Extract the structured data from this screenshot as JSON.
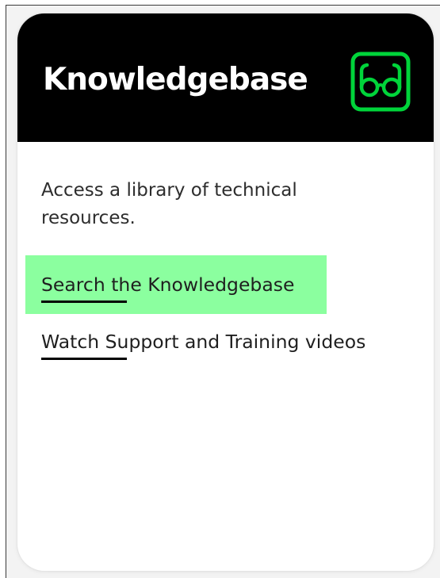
{
  "card": {
    "title": "Knowledgebase",
    "icon": "glasses-icon",
    "description": "Access a library of technical resources.",
    "links": [
      {
        "label": "Search the Knowledgebase",
        "highlighted": true
      },
      {
        "label": "Watch Support and Training videos",
        "highlighted": false
      }
    ]
  },
  "colors": {
    "header_bg": "#000000",
    "accent_green": "#00d43a",
    "highlight_green": "#8bff9f",
    "text": "#2d2d2d"
  }
}
